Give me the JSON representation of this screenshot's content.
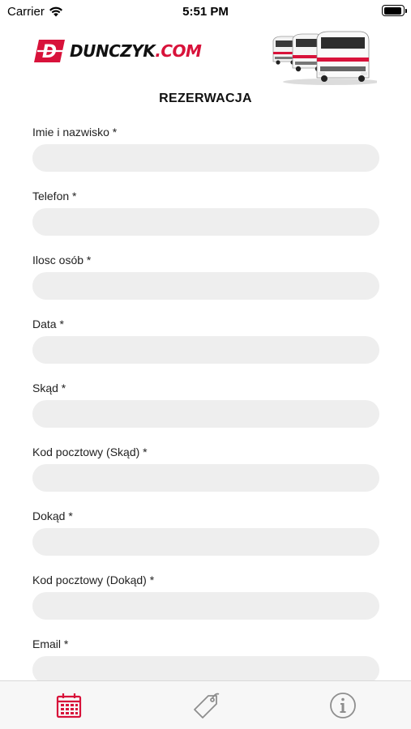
{
  "status_bar": {
    "carrier": "Carrier",
    "time": "5:51 PM",
    "battery_level": 0.95
  },
  "header": {
    "logo_text_main": "DUNCZYK",
    "logo_text_suffix": ".COM",
    "logo_mark_letter": "D",
    "brand_color": "#d8123a"
  },
  "page": {
    "title": "REZERWACJA"
  },
  "form": {
    "fields": [
      {
        "label": "Imie i nazwisko *",
        "value": "",
        "placeholder": ""
      },
      {
        "label": "Telefon *",
        "value": "",
        "placeholder": ""
      },
      {
        "label": "Ilosc osób *",
        "value": "",
        "placeholder": ""
      },
      {
        "label": "Data *",
        "value": "",
        "placeholder": ""
      },
      {
        "label": "Skąd *",
        "value": "",
        "placeholder": ""
      },
      {
        "label": "Kod pocztowy (Skąd) *",
        "value": "",
        "placeholder": ""
      },
      {
        "label": "Dokąd *",
        "value": "",
        "placeholder": ""
      },
      {
        "label": "Kod pocztowy (Dokąd) *",
        "value": "",
        "placeholder": ""
      },
      {
        "label": "Email *",
        "value": "",
        "placeholder": ""
      }
    ]
  },
  "tab_bar": {
    "tabs": [
      {
        "icon": "calendar-icon",
        "active": true,
        "color": "#d8123a"
      },
      {
        "icon": "price-tag-icon",
        "active": false,
        "color": "#8e8e8e"
      },
      {
        "icon": "info-icon",
        "active": false,
        "color": "#8e8e8e"
      }
    ]
  }
}
